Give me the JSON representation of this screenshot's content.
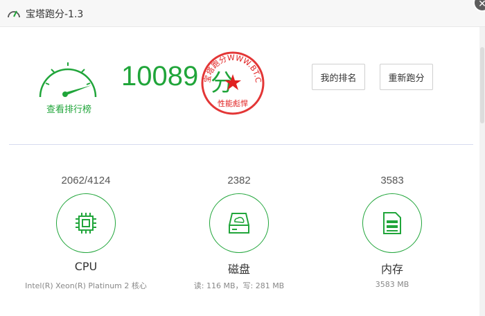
{
  "window": {
    "title": "宝塔跑分-1.3",
    "close_glyph": "✕"
  },
  "gauge": {
    "link_label": "查看排行榜",
    "accent": "#20a53a"
  },
  "score": {
    "value": "10089",
    "unit": "分"
  },
  "stamp": {
    "ring_text": "宝塔跑分WWW.BT.CN",
    "bottom_text": "性能彪悍",
    "color": "#e02020"
  },
  "buttons": {
    "rank_label": "我的排名",
    "rerun_label": "重新跑分"
  },
  "metrics": [
    {
      "value": "2062/4124",
      "name": "CPU",
      "desc": "Intel(R) Xeon(R) Platinum 2 核心",
      "icon": "cpu-chip-icon"
    },
    {
      "value": "2382",
      "name": "磁盘",
      "desc": "读: 116 MB，写: 281 MB",
      "icon": "disk-drive-icon"
    },
    {
      "value": "3583",
      "name": "内存",
      "desc": "3583 MB",
      "icon": "memory-card-icon"
    }
  ]
}
